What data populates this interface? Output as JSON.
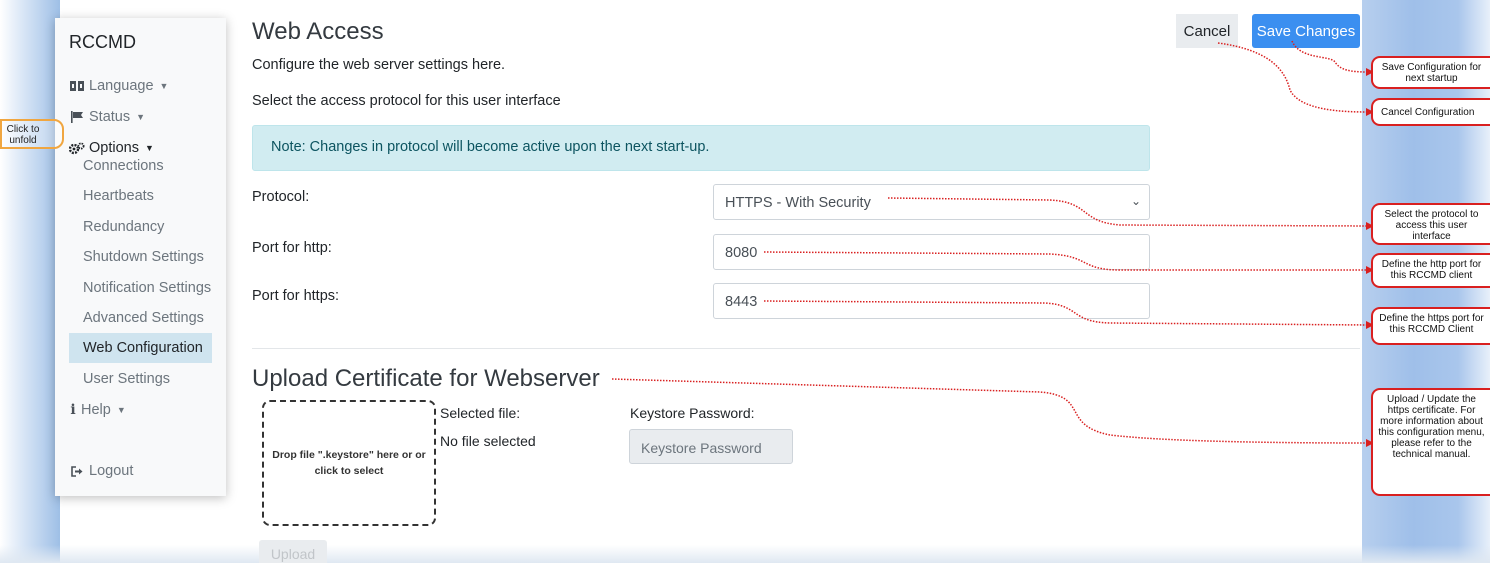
{
  "sidebar": {
    "brand": "RCCMD",
    "language": "Language",
    "status": "Status",
    "options": "Options",
    "sub_items": [
      "Connections",
      "Heartbeats",
      "Redundancy",
      "Shutdown Settings",
      "Notification Settings",
      "Advanced Settings",
      "Web Configuration",
      "User Settings"
    ],
    "active_sub_item": "Web Configuration",
    "help": "Help",
    "logout": "Logout"
  },
  "unfold_hint": "Click to unfold",
  "header": {
    "title": "Web Access",
    "cancel_label": "Cancel",
    "save_label": "Save Changes"
  },
  "main": {
    "description": "Configure the web server settings here.",
    "protocol_prompt": "Select the access protocol for this user interface",
    "note": "Note: Changes in protocol will become active upon the next start-up.",
    "protocol_label": "Protocol:",
    "protocol_value": "HTTPS - With Security",
    "http_label": "Port for http:",
    "http_value": "8080",
    "https_label": "Port for https:",
    "https_value": "8443"
  },
  "certificate": {
    "title": "Upload Certificate for Webserver",
    "dropzone_text": "Drop file \".keystore\" here or or click to select",
    "selected_file_label": "Selected file:",
    "selected_file_value": "No file selected",
    "keystore_label": "Keystore Password:",
    "keystore_placeholder": "Keystore Password",
    "upload_label": "Upload"
  },
  "annotations": {
    "save": "Save Configuration for next startup",
    "cancel": "Cancel Configuration",
    "protocol": "Select the protocol to access this user interface",
    "http": "Define the http port for this RCCMD client",
    "https": "Define the https port for this RCCMD Client",
    "certificate": "Upload / Update the https certificate. For more information about this configuration menu, please refer to the technical manual."
  },
  "colors": {
    "primary": "#3b8ff0",
    "note_bg": "#d1ecf1",
    "note_text": "#0c5460",
    "active_nav": "#cfe4ef",
    "annotation_red": "#d92020",
    "unfold_orange": "#f0a640"
  }
}
